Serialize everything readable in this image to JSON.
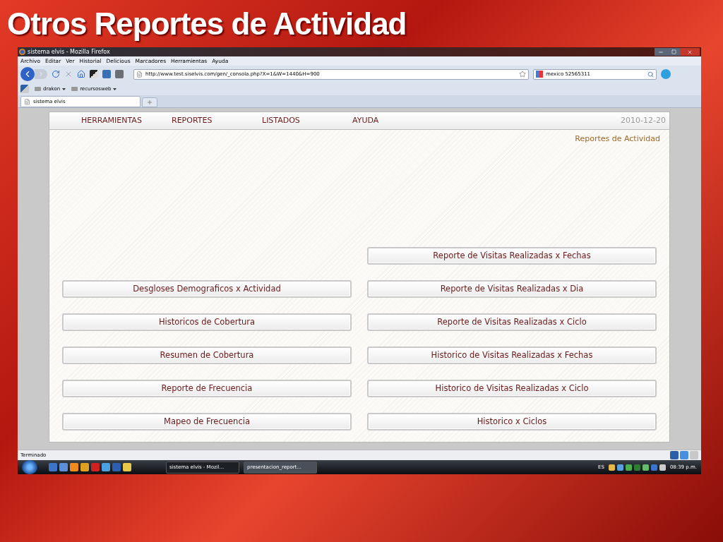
{
  "slide_title": "Otros Reportes de Actividad",
  "window": {
    "title": "sistema elvis - Mozilla Firefox"
  },
  "menu_bar": [
    "Archivo",
    "Editar",
    "Ver",
    "Historial",
    "Delicious",
    "Marcadores",
    "Herramientas",
    "Ayuda"
  ],
  "address_bar": {
    "value": "http://www.test.siselvis.com/gen/_consola.php?X=1&W=1440&H=900"
  },
  "search_bar": {
    "value": "mexico 52565311"
  },
  "bookmarks": [
    "drakon",
    "recursosweb"
  ],
  "tabs": [
    {
      "label": "sistema elvis",
      "selected": true
    }
  ],
  "page": {
    "nav": [
      "HERRAMIENTAS",
      "REPORTES",
      "LISTADOS",
      "AYUDA"
    ],
    "date": "2010-12-20",
    "section_title": "Reportes de Actividad",
    "left_buttons": [
      "Desgloses Demograficos x Actividad",
      "Historicos de Cobertura",
      "Resumen de Cobertura",
      "Reporte de Frecuencia",
      "Mapeo de Frecuencia"
    ],
    "right_buttons": [
      "Reporte de Visitas Realizadas x Fechas",
      "Reporte de Visitas Realizadas x Dia",
      "Reporte de Visitas Realizadas x Ciclo",
      "Historico de Visitas Realizadas x Fechas",
      "Historico de Visitas Realizadas x Ciclo",
      "Historico x Ciclos"
    ]
  },
  "status_bar": "Terminado",
  "taskbar": {
    "windows": [
      {
        "label": "sistema elvis - Mozil...",
        "selected": true
      },
      {
        "label": "presentacion_report...",
        "selected": false
      }
    ],
    "language": "ES",
    "clock": "08:39 p.m."
  }
}
